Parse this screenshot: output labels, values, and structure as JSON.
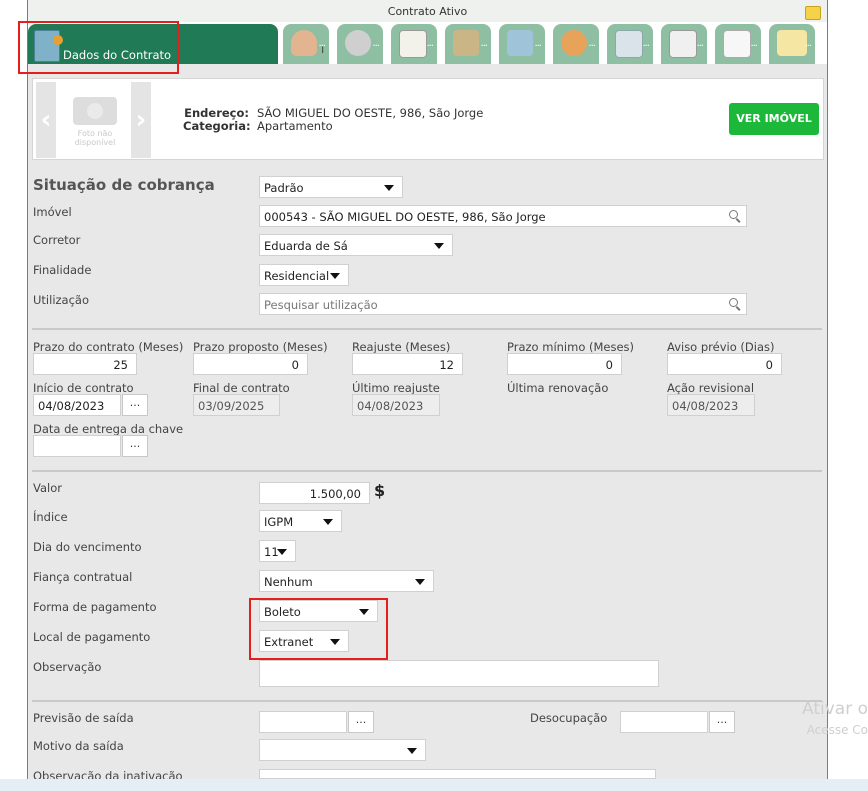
{
  "window": {
    "title": "Contrato Ativo"
  },
  "tabs": {
    "active_label": "Dados do Contrato",
    "tab2_marker": "I",
    "more": "..."
  },
  "property": {
    "photo_text": "Foto não disponível",
    "address_label": "Endereço:",
    "address_value": "SÃO MIGUEL DO OESTE, 986, São Jorge",
    "category_label": "Categoria:",
    "category_value": "Apartamento",
    "view_button": "VER IMÓVEL",
    "prev_arrow": "‹",
    "next_arrow": "›"
  },
  "form": {
    "situacao_label": "Situação de cobrança",
    "situacao_value": "Padrão",
    "imovel_label": "Imóvel",
    "imovel_value": "000543 - SÃO MIGUEL DO OESTE, 986, São Jorge",
    "corretor_label": "Corretor",
    "corretor_value": "Eduarda de Sá",
    "finalidade_label": "Finalidade",
    "finalidade_value": "Residencial",
    "utilizacao_label": "Utilização",
    "utilizacao_placeholder": "Pesquisar utilização"
  },
  "prazos": {
    "prazo_contrato_label": "Prazo do contrato (Meses)",
    "prazo_contrato_value": "25",
    "prazo_proposto_label": "Prazo proposto (Meses)",
    "prazo_proposto_value": "0",
    "reajuste_label": "Reajuste (Meses)",
    "reajuste_value": "12",
    "prazo_minimo_label": "Prazo mínimo (Meses)",
    "prazo_minimo_value": "0",
    "aviso_label": "Aviso prévio (Dias)",
    "aviso_value": "0",
    "inicio_label": "Início de contrato",
    "inicio_value": "04/08/2023",
    "final_label": "Final de contrato",
    "final_value": "03/09/2025",
    "ultimo_reajuste_label": "Último reajuste",
    "ultimo_reajuste_value": "04/08/2023",
    "ultima_renovacao_label": "Última renovação",
    "acao_revisional_label": "Ação revisional",
    "acao_revisional_value": "04/08/2023",
    "entrega_chave_label": "Data de entrega da chave",
    "dots": "..."
  },
  "valores": {
    "valor_label": "Valor",
    "valor_value": "1.500,00",
    "currency_symbol": "$",
    "indice_label": "Índice",
    "indice_value": "IGPM",
    "dia_label": "Dia do vencimento",
    "dia_value": "11",
    "fianca_label": "Fiança contratual",
    "fianca_value": "Nenhum",
    "forma_label": "Forma de pagamento",
    "forma_value": "Boleto",
    "local_label": "Local de pagamento",
    "local_value": "Extranet",
    "obs_label": "Observação"
  },
  "saida": {
    "previsao_label": "Previsão de saída",
    "desocupacao_label": "Desocupação",
    "motivo_label": "Motivo da saída",
    "obs_inativacao_label": "Observação da inativação"
  },
  "watermark": {
    "line1": "Ativar o",
    "line2": "Acesse Co"
  },
  "colors": {
    "primary_green": "#1f7a55",
    "tab_green": "#8fbfa3",
    "button_green": "#1cb83a",
    "highlight_red": "#e5201c"
  }
}
